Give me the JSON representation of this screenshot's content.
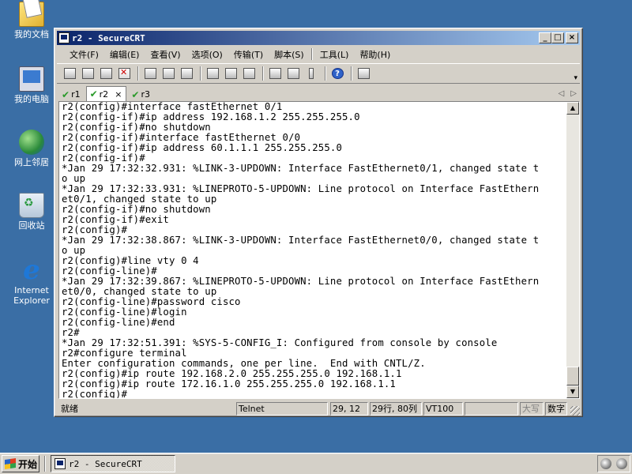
{
  "desktop": {
    "icons": [
      {
        "label": "我的文档",
        "icon": "my-documents-icon"
      },
      {
        "label": "我的电脑",
        "icon": "my-computer-icon"
      },
      {
        "label": "网上邻居",
        "icon": "network-places-icon"
      },
      {
        "label": "回收站",
        "icon": "recycle-bin-icon"
      },
      {
        "label": "Internet Explorer",
        "icon": "internet-explorer-icon"
      }
    ]
  },
  "window": {
    "title": "r2 - SecureCRT",
    "buttons": {
      "minimize": "_",
      "maximize": "□",
      "close": "×"
    }
  },
  "menu": {
    "items": [
      "文件(F)",
      "编辑(E)",
      "查看(V)",
      "选项(O)",
      "传输(T)",
      "脚本(S)",
      "工具(L)",
      "帮助(H)"
    ]
  },
  "toolbar": {
    "icons": [
      "connect-icon",
      "quick-connect-icon",
      "connect-in-tab-icon",
      "disconnect-icon",
      "copy-icon",
      "paste-icon",
      "find-icon",
      "print-setup-icon",
      "print-selection-icon",
      "print-icon",
      "session-options-icon",
      "global-options-icon",
      "keymap-icon",
      "help-icon",
      "sftp-icon"
    ]
  },
  "tabs": [
    {
      "label": "r1",
      "active": false
    },
    {
      "label": "r2",
      "active": true,
      "close": "×"
    },
    {
      "label": "r3",
      "active": false
    }
  ],
  "tab_nav": {
    "prev": "◁",
    "next": "▷"
  },
  "terminal": {
    "lines": [
      "r2(config)#interface fastEthernet 0/1",
      "r2(config-if)#ip address 192.168.1.2 255.255.255.0",
      "r2(config-if)#no shutdown",
      "r2(config-if)#interface fastEthernet 0/0",
      "r2(config-if)#ip address 60.1.1.1 255.255.255.0",
      "r2(config-if)#",
      "*Jan 29 17:32:32.931: %LINK-3-UPDOWN: Interface FastEthernet0/1, changed state t",
      "o up",
      "*Jan 29 17:32:33.931: %LINEPROTO-5-UPDOWN: Line protocol on Interface FastEthern",
      "et0/1, changed state to up",
      "r2(config-if)#no shutdown",
      "r2(config-if)#exit",
      "r2(config)#",
      "*Jan 29 17:32:38.867: %LINK-3-UPDOWN: Interface FastEthernet0/0, changed state t",
      "o up",
      "r2(config)#line vty 0 4",
      "r2(config-line)#",
      "*Jan 29 17:32:39.867: %LINEPROTO-5-UPDOWN: Line protocol on Interface FastEthern",
      "et0/0, changed state to up",
      "r2(config-line)#password cisco",
      "r2(config-line)#login",
      "r2(config-line)#end",
      "r2#",
      "*Jan 29 17:32:51.391: %SYS-5-CONFIG_I: Configured from console by console",
      "r2#configure terminal",
      "Enter configuration commands, one per line.  End with CNTL/Z.",
      "r2(config)#ip route 192.168.2.0 255.255.255.0 192.168.1.1",
      "r2(config)#ip route 172.16.1.0 255.255.255.0 192.168.1.1",
      "r2(config)#"
    ]
  },
  "statusbar": {
    "ready": "就绪",
    "protocol": "Telnet",
    "cursor": "29, 12",
    "size": "29行, 80列",
    "emulation": "VT100",
    "empty": "",
    "caps": "大写",
    "num": "数字"
  },
  "taskbar": {
    "start_label": "开始",
    "task_label": "r2 - SecureCRT"
  }
}
